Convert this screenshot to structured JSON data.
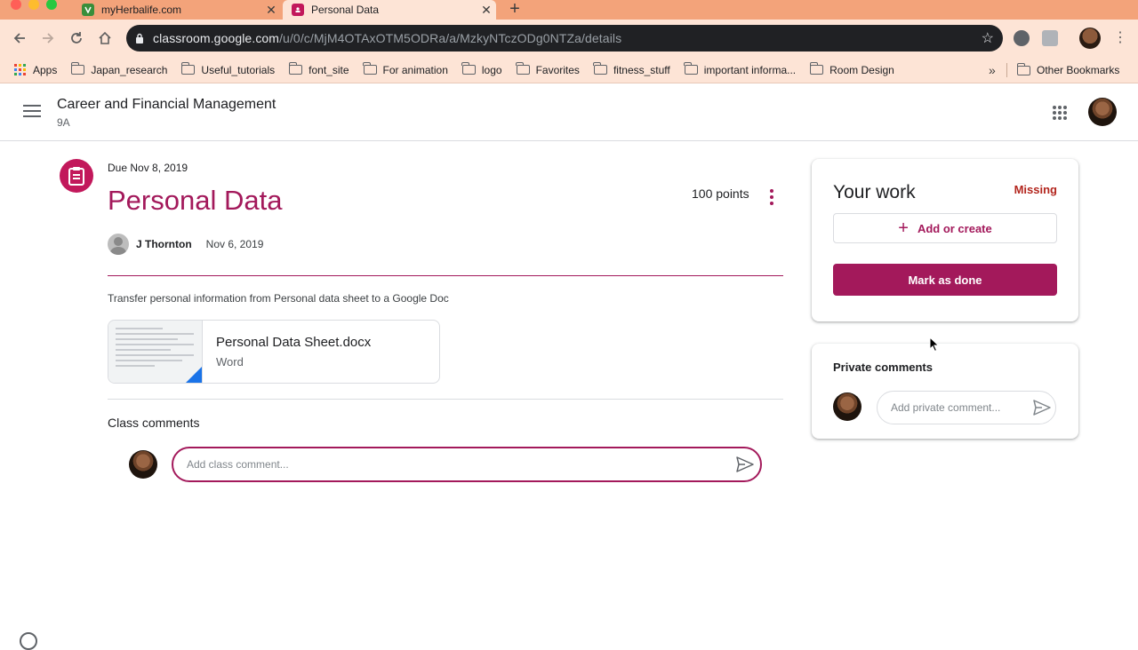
{
  "browser": {
    "tabs": [
      {
        "title": "myHerbalife.com",
        "active": false
      },
      {
        "title": "Personal Data",
        "active": true
      }
    ],
    "url_host": "classroom.google.com",
    "url_path": "/u/0/c/MjM4OTAxOTM5ODRa/a/MzkyNTczODg0NTZa/details",
    "bookmarks": {
      "apps": "Apps",
      "items": [
        "Japan_research",
        "Useful_tutorials",
        "font_site",
        "For animation",
        "logo",
        "Favorites",
        "fitness_stuff",
        "important informa...",
        "Room Design"
      ],
      "more": "»",
      "other": "Other Bookmarks"
    }
  },
  "header": {
    "class_name": "Career and Financial Management",
    "section": "9A"
  },
  "assignment": {
    "due": "Due Nov 8, 2019",
    "title": "Personal Data",
    "points": "100 points",
    "author": "J Thornton",
    "posted": "Nov 6, 2019",
    "instructions": "Transfer personal information from Personal data sheet to a Google Doc",
    "attachment": {
      "name": "Personal Data Sheet.docx",
      "type": "Word"
    }
  },
  "class_comments": {
    "heading": "Class comments",
    "placeholder": "Add class comment..."
  },
  "your_work": {
    "title": "Your work",
    "status": "Missing",
    "add_label": "Add or create",
    "done_label": "Mark as done"
  },
  "private_comments": {
    "heading": "Private comments",
    "placeholder": "Add private comment..."
  },
  "colors": {
    "accent": "#a3195b",
    "status_missing": "#b3261e",
    "tab_strip": "#f3a37a",
    "toolbar": "#fde4d6"
  },
  "icons": [
    "close-icon",
    "plus-icon",
    "back-icon",
    "forward-icon",
    "reload-icon",
    "home-icon",
    "lock-icon",
    "star-icon",
    "apps-icon",
    "folder-icon",
    "hamburger-icon",
    "google-apps-icon",
    "assignment-icon",
    "more-vert-icon",
    "send-icon"
  ]
}
